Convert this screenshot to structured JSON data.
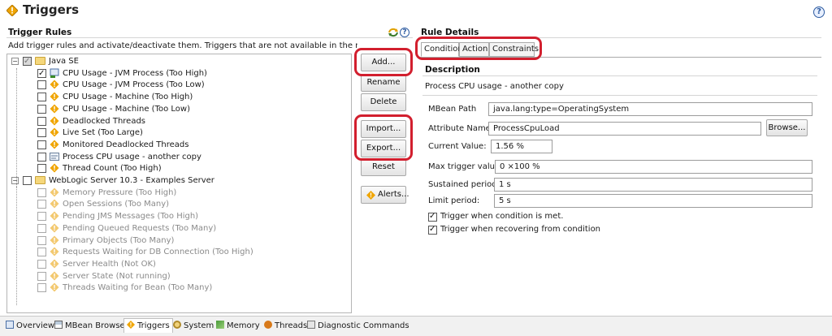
{
  "header": {
    "title": "Triggers",
    "help_icon": "help-icon"
  },
  "trigger_rules": {
    "title": "Trigger Rules",
    "description": "Add trigger rules and activate/deactivate them. Triggers that are not available in the monitored JVM are grayed out."
  },
  "tree": [
    {
      "label": "Java SE"
    },
    {
      "label": "CPU Usage - JVM Process (Too High)"
    },
    {
      "label": "CPU Usage - JVM Process (Too Low)"
    },
    {
      "label": "CPU Usage - Machine (Too High)"
    },
    {
      "label": "CPU Usage - Machine (Too Low)"
    },
    {
      "label": "Deadlocked Threads"
    },
    {
      "label": "Live Set (Too Large)"
    },
    {
      "label": "Monitored Deadlocked Threads"
    },
    {
      "label": "Process CPU usage - another copy"
    },
    {
      "label": "Thread Count (Too High)"
    },
    {
      "label": "WebLogic Server 10.3 - Examples Server"
    },
    {
      "label": "Memory Pressure (Too High)"
    },
    {
      "label": "Open Sessions (Too Many)"
    },
    {
      "label": "Pending JMS Messages (Too High)"
    },
    {
      "label": "Pending Queued Requests (Too Many)"
    },
    {
      "label": "Primary Objects (Too Many)"
    },
    {
      "label": "Requests Waiting for DB Connection (Too High)"
    },
    {
      "label": "Server Health (Not OK)"
    },
    {
      "label": "Server State (Not running)"
    },
    {
      "label": "Threads Waiting for Bean (Too Many)"
    }
  ],
  "buttons": {
    "add": "Add...",
    "rename": "Rename",
    "delete": "Delete",
    "import": "Import...",
    "export": "Export...",
    "reset": "Reset",
    "alerts": "Alerts..."
  },
  "rule_details": {
    "title": "Rule Details",
    "tabs": [
      "Condition",
      "Action",
      "Constraints"
    ],
    "description_heading": "Description",
    "description_text": "Process CPU usage - another copy",
    "mbean_path_label": "MBean Path",
    "mbean_path_value": "java.lang:type=OperatingSystem",
    "attribute_label": "Attribute Name:",
    "attribute_value": "ProcessCpuLoad",
    "browse": "Browse...",
    "current_value_label": "Current Value:",
    "current_value": "1.56 %",
    "max_trigger_label": "Max trigger value:",
    "max_trigger_value": "0 ×100 %",
    "sustained_label": "Sustained period:",
    "sustained_value": "1 s",
    "limit_label": "Limit period:",
    "limit_value": "5 s",
    "check_met": "Trigger when condition is met.",
    "check_recover": "Trigger when recovering from condition"
  },
  "bottom_tabs": [
    "Overview",
    "MBean Browser",
    "Triggers",
    "System",
    "Memory",
    "Threads",
    "Diagnostic Commands"
  ],
  "colors": {
    "highlight_circle": "#d21f2e",
    "warning": "#f0a500"
  }
}
